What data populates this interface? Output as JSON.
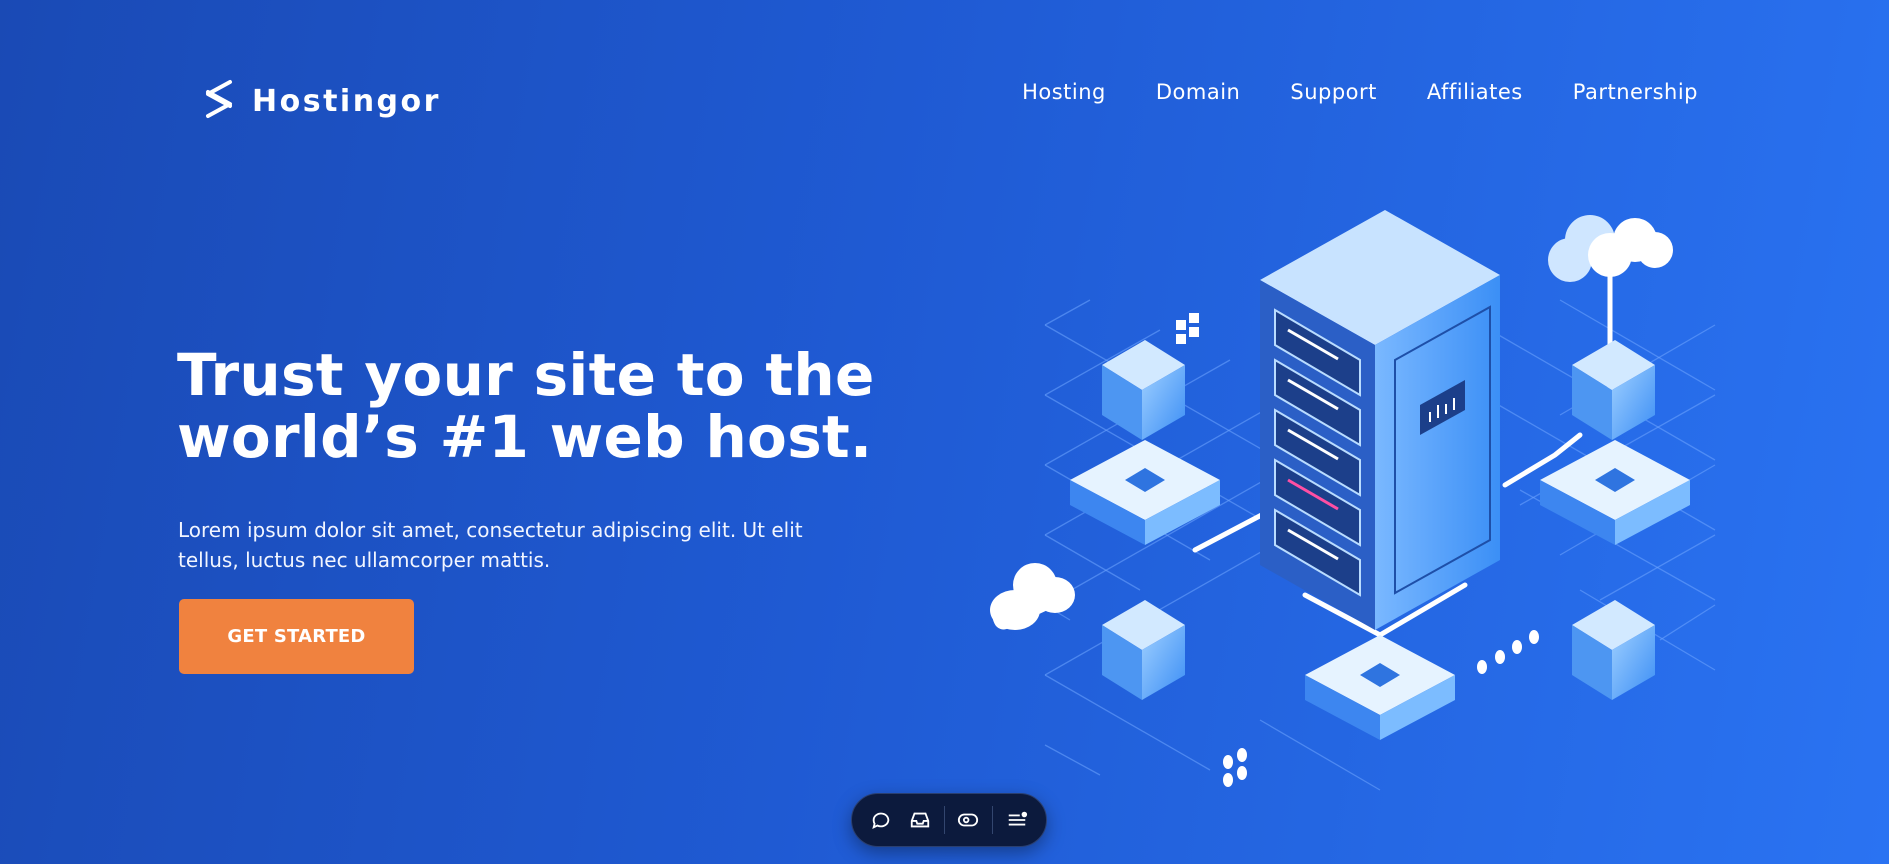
{
  "brand": {
    "name": "Hostingor",
    "icon": "layered-s-logo-icon"
  },
  "nav": {
    "items": [
      "Hosting",
      "Domain",
      "Support",
      "Affiliates",
      "Partnership"
    ]
  },
  "hero": {
    "title_line1": "Trust your site to the",
    "title_line2": "world’s #1 web host.",
    "description": "Lorem ipsum dolor sit amet, consectetur adipiscing elit. Ut elit tellus, luctus nec ullamcorper mattis.",
    "cta_label": "GET STARTED"
  },
  "illustration": {
    "icon": "isometric-server-network-icon"
  },
  "toolbar": {
    "icons": [
      "chat-bubble-icon",
      "inbox-icon",
      "eye-icon",
      "menu-list-icon"
    ]
  },
  "colors": {
    "background_start": "#1a4ab5",
    "background_end": "#2a73f2",
    "cta": "#f0823f",
    "toolbar": "#0c1a3d"
  }
}
